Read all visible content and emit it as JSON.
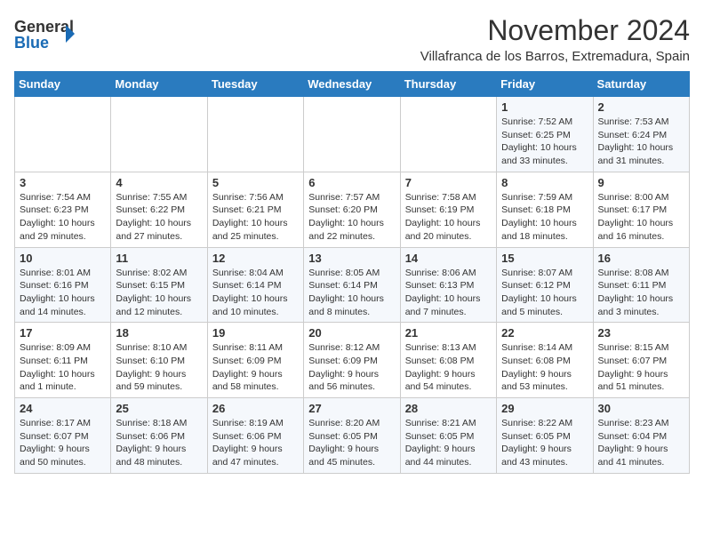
{
  "logo": {
    "line1": "General",
    "line2": "Blue"
  },
  "title": "November 2024",
  "subtitle": "Villafranca de los Barros, Extremadura, Spain",
  "weekdays": [
    "Sunday",
    "Monday",
    "Tuesday",
    "Wednesday",
    "Thursday",
    "Friday",
    "Saturday"
  ],
  "weeks": [
    [
      {
        "day": "",
        "info": ""
      },
      {
        "day": "",
        "info": ""
      },
      {
        "day": "",
        "info": ""
      },
      {
        "day": "",
        "info": ""
      },
      {
        "day": "",
        "info": ""
      },
      {
        "day": "1",
        "info": "Sunrise: 7:52 AM\nSunset: 6:25 PM\nDaylight: 10 hours and 33 minutes."
      },
      {
        "day": "2",
        "info": "Sunrise: 7:53 AM\nSunset: 6:24 PM\nDaylight: 10 hours and 31 minutes."
      }
    ],
    [
      {
        "day": "3",
        "info": "Sunrise: 7:54 AM\nSunset: 6:23 PM\nDaylight: 10 hours and 29 minutes."
      },
      {
        "day": "4",
        "info": "Sunrise: 7:55 AM\nSunset: 6:22 PM\nDaylight: 10 hours and 27 minutes."
      },
      {
        "day": "5",
        "info": "Sunrise: 7:56 AM\nSunset: 6:21 PM\nDaylight: 10 hours and 25 minutes."
      },
      {
        "day": "6",
        "info": "Sunrise: 7:57 AM\nSunset: 6:20 PM\nDaylight: 10 hours and 22 minutes."
      },
      {
        "day": "7",
        "info": "Sunrise: 7:58 AM\nSunset: 6:19 PM\nDaylight: 10 hours and 20 minutes."
      },
      {
        "day": "8",
        "info": "Sunrise: 7:59 AM\nSunset: 6:18 PM\nDaylight: 10 hours and 18 minutes."
      },
      {
        "day": "9",
        "info": "Sunrise: 8:00 AM\nSunset: 6:17 PM\nDaylight: 10 hours and 16 minutes."
      }
    ],
    [
      {
        "day": "10",
        "info": "Sunrise: 8:01 AM\nSunset: 6:16 PM\nDaylight: 10 hours and 14 minutes."
      },
      {
        "day": "11",
        "info": "Sunrise: 8:02 AM\nSunset: 6:15 PM\nDaylight: 10 hours and 12 minutes."
      },
      {
        "day": "12",
        "info": "Sunrise: 8:04 AM\nSunset: 6:14 PM\nDaylight: 10 hours and 10 minutes."
      },
      {
        "day": "13",
        "info": "Sunrise: 8:05 AM\nSunset: 6:14 PM\nDaylight: 10 hours and 8 minutes."
      },
      {
        "day": "14",
        "info": "Sunrise: 8:06 AM\nSunset: 6:13 PM\nDaylight: 10 hours and 7 minutes."
      },
      {
        "day": "15",
        "info": "Sunrise: 8:07 AM\nSunset: 6:12 PM\nDaylight: 10 hours and 5 minutes."
      },
      {
        "day": "16",
        "info": "Sunrise: 8:08 AM\nSunset: 6:11 PM\nDaylight: 10 hours and 3 minutes."
      }
    ],
    [
      {
        "day": "17",
        "info": "Sunrise: 8:09 AM\nSunset: 6:11 PM\nDaylight: 10 hours and 1 minute."
      },
      {
        "day": "18",
        "info": "Sunrise: 8:10 AM\nSunset: 6:10 PM\nDaylight: 9 hours and 59 minutes."
      },
      {
        "day": "19",
        "info": "Sunrise: 8:11 AM\nSunset: 6:09 PM\nDaylight: 9 hours and 58 minutes."
      },
      {
        "day": "20",
        "info": "Sunrise: 8:12 AM\nSunset: 6:09 PM\nDaylight: 9 hours and 56 minutes."
      },
      {
        "day": "21",
        "info": "Sunrise: 8:13 AM\nSunset: 6:08 PM\nDaylight: 9 hours and 54 minutes."
      },
      {
        "day": "22",
        "info": "Sunrise: 8:14 AM\nSunset: 6:08 PM\nDaylight: 9 hours and 53 minutes."
      },
      {
        "day": "23",
        "info": "Sunrise: 8:15 AM\nSunset: 6:07 PM\nDaylight: 9 hours and 51 minutes."
      }
    ],
    [
      {
        "day": "24",
        "info": "Sunrise: 8:17 AM\nSunset: 6:07 PM\nDaylight: 9 hours and 50 minutes."
      },
      {
        "day": "25",
        "info": "Sunrise: 8:18 AM\nSunset: 6:06 PM\nDaylight: 9 hours and 48 minutes."
      },
      {
        "day": "26",
        "info": "Sunrise: 8:19 AM\nSunset: 6:06 PM\nDaylight: 9 hours and 47 minutes."
      },
      {
        "day": "27",
        "info": "Sunrise: 8:20 AM\nSunset: 6:05 PM\nDaylight: 9 hours and 45 minutes."
      },
      {
        "day": "28",
        "info": "Sunrise: 8:21 AM\nSunset: 6:05 PM\nDaylight: 9 hours and 44 minutes."
      },
      {
        "day": "29",
        "info": "Sunrise: 8:22 AM\nSunset: 6:05 PM\nDaylight: 9 hours and 43 minutes."
      },
      {
        "day": "30",
        "info": "Sunrise: 8:23 AM\nSunset: 6:04 PM\nDaylight: 9 hours and 41 minutes."
      }
    ]
  ]
}
